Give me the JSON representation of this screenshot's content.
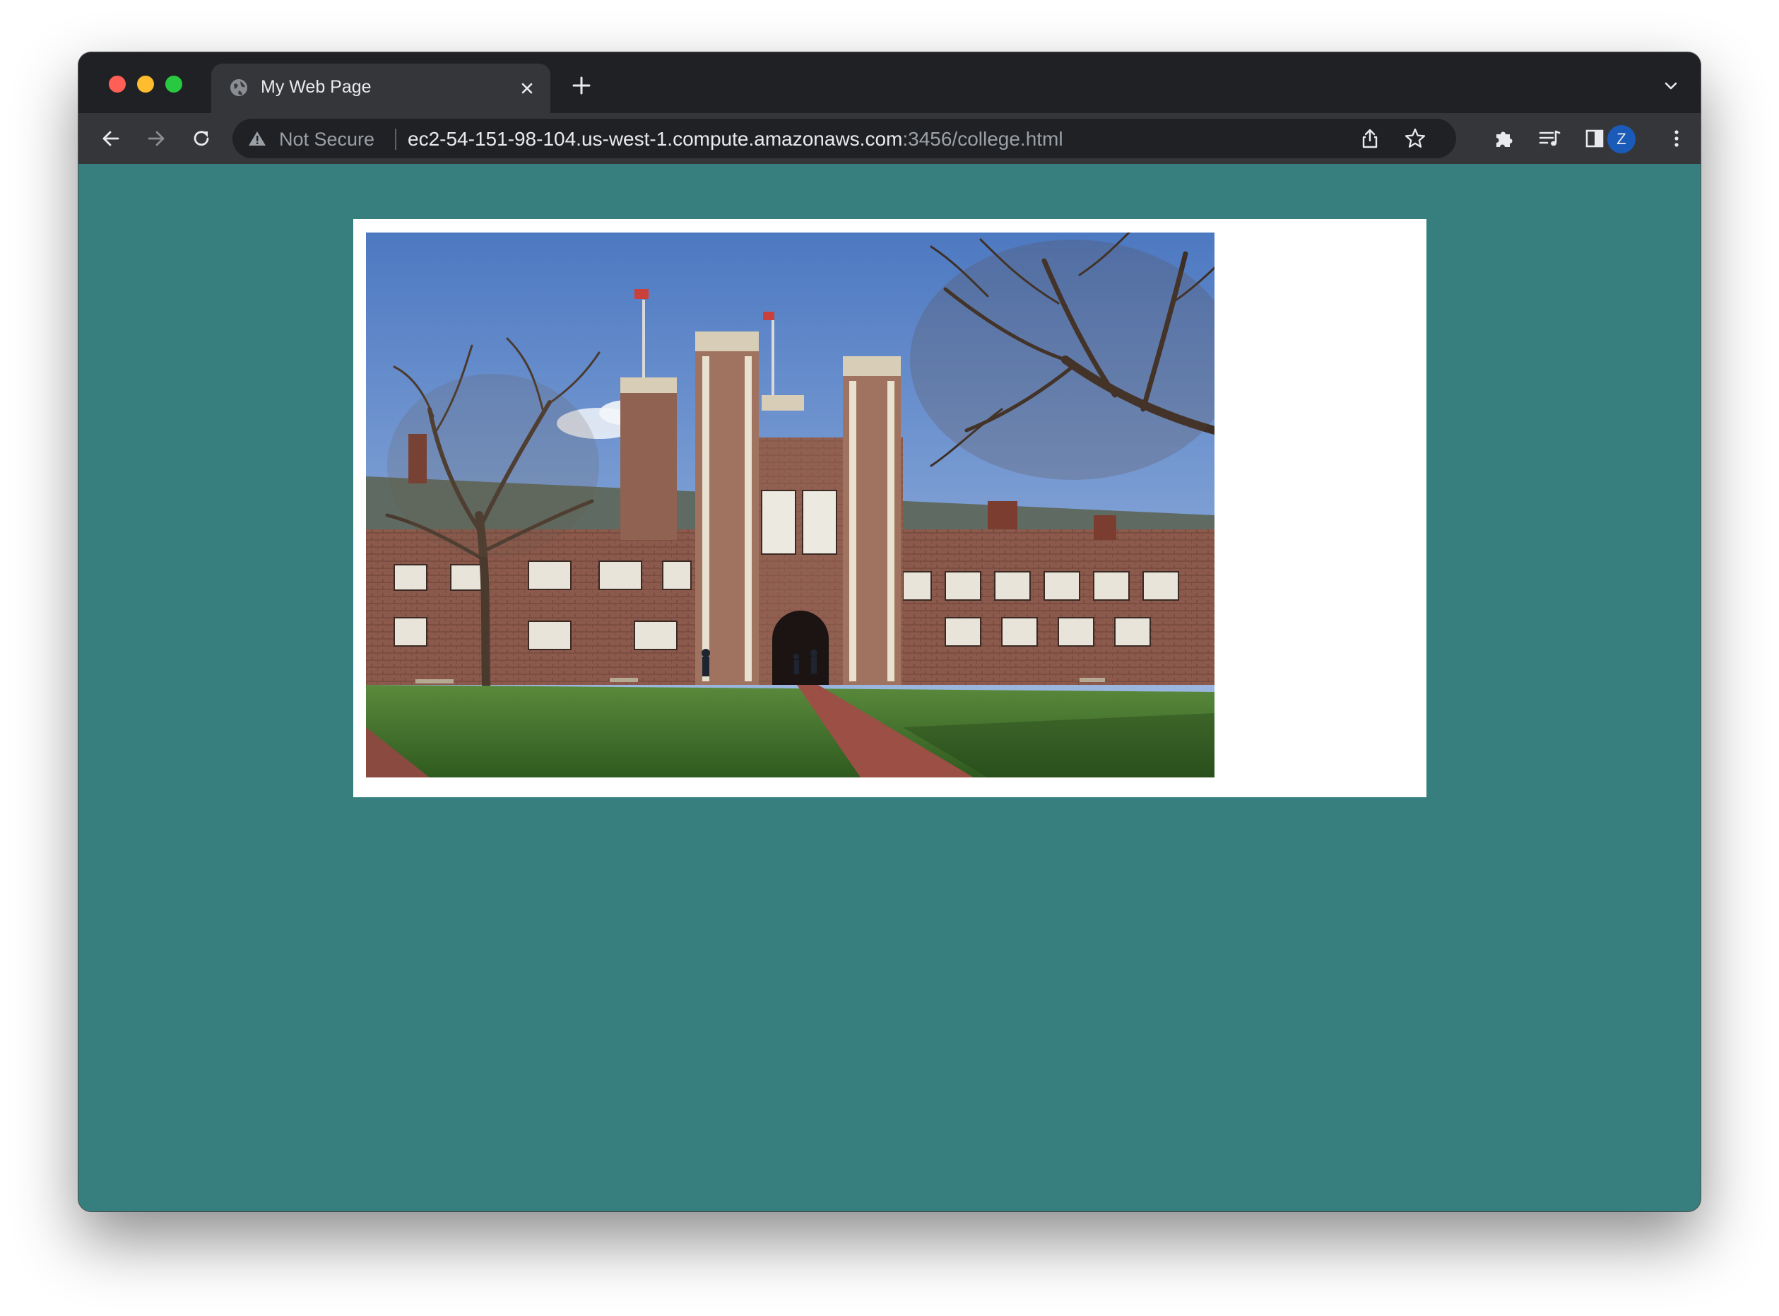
{
  "browser": {
    "tab": {
      "title": "My Web Page",
      "favicon": "globe-icon"
    },
    "address_bar": {
      "security_label": "Not Secure",
      "url_host": "ec2-54-151-98-104.us-west-1.compute.amazonaws.com",
      "url_path": ":3456/college.html"
    },
    "profile_initial": "Z",
    "icons": [
      "back-icon",
      "forward-icon",
      "reload-icon",
      "share-icon",
      "bookmark-star-icon",
      "extensions-icon",
      "media-icon",
      "side-panel-icon",
      "menu-icon"
    ]
  },
  "page": {
    "background_color": "#367f7e",
    "panel_color": "#ffffff",
    "image_subject": "college-building-photo"
  }
}
